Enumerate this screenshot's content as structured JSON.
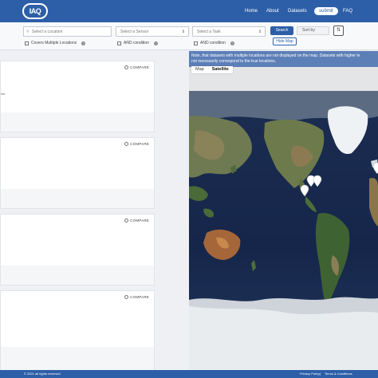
{
  "header": {
    "logo_text": "IAQ",
    "nav": [
      "Home",
      "About",
      "Datasets"
    ],
    "submit_label": "submit",
    "faq_label": "FAQ"
  },
  "filters": {
    "location_placeholder": "Select a Location",
    "sensor_placeholder": "Select a Sensor",
    "task_placeholder": "Select a Task",
    "covers_multiple": "Covers Multiple Locations",
    "and_condition_1": "AND condition",
    "and_condition_2": "AND condition",
    "search_label": "Search",
    "hide_map_label": "Hide Map",
    "sort_by_placeholder": "Sort by",
    "help_glyph": "?"
  },
  "results": {
    "compare_label": "COMPARE",
    "first_card_snippet": "ner"
  },
  "map": {
    "notice_line1": "Note, that datasets with multiple locations are not displayed on the map. Datasets with higher le",
    "notice_line2": "not necessarily correspond to the true locations.",
    "map_label": "Map",
    "satellite_label": "Satellite"
  },
  "footer": {
    "copyright": "© 2021 all rights reserved",
    "privacy": "Privacy Policy",
    "separator": "|",
    "terms": "Terms & Conditions"
  },
  "colors": {
    "brand_blue": "#2d5fa8",
    "notice_blue": "#5d7fb8"
  }
}
